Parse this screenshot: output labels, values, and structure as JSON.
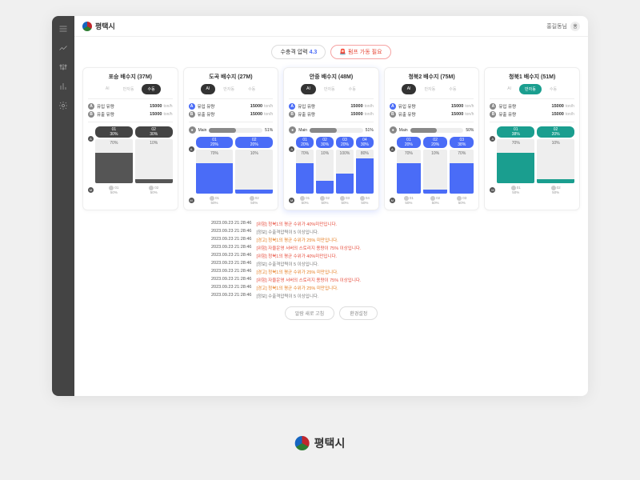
{
  "app_name": "평택시",
  "user": {
    "name": "홍길동님",
    "badge": "홍"
  },
  "top_pills": {
    "pressure": {
      "label": "수충격 압력",
      "value": "4.3"
    },
    "pump": {
      "label": "펌프 가동 필요",
      "icon": "🚨"
    }
  },
  "flow_labels": {
    "in": "유입 유량",
    "out": "유출 유량",
    "unit": "ton/h"
  },
  "mode_labels": [
    "AI",
    "반자동",
    "수동"
  ],
  "cards": [
    {
      "title": "포승 배수지 (37M)",
      "mode_active": 2,
      "mode_style": "dark",
      "hl": false,
      "in": "15000",
      "out": "15000",
      "main": null,
      "tanks": [
        {
          "tag": "01",
          "tag_style": "dark",
          "tag_pct": "30%",
          "fill": 70,
          "fill_style": "dark",
          "top": "70%",
          "foot_id": "01",
          "foot_pct": "50%"
        },
        {
          "tag": "02",
          "tag_style": "dark",
          "tag_pct": "30%",
          "fill": 10,
          "fill_style": "dark",
          "top": "10%",
          "foot_id": "02",
          "foot_pct": "50%"
        }
      ]
    },
    {
      "title": "도곡 배수지 (27M)",
      "mode_active": 0,
      "mode_style": "dark",
      "hl": false,
      "in": "15000",
      "out": "15000",
      "main": "51%",
      "tanks": [
        {
          "tag": "01",
          "tag_style": "blue",
          "tag_pct": "20%",
          "fill": 70,
          "fill_style": "blue",
          "top": "70%",
          "foot_id": "01",
          "foot_pct": "50%"
        },
        {
          "tag": "02",
          "tag_style": "blue",
          "tag_pct": "20%",
          "fill": 10,
          "fill_style": "blue",
          "top": "10%",
          "foot_id": "02",
          "foot_pct": "50%"
        }
      ]
    },
    {
      "title": "안중 배수지 (48M)",
      "mode_active": 0,
      "mode_style": "dark",
      "hl": true,
      "in": "15000",
      "out": "15000",
      "main": "51%",
      "tanks": [
        {
          "tag": "01",
          "tag_style": "blue",
          "tag_pct": "20%",
          "fill": 70,
          "fill_style": "blue",
          "top": "70%",
          "foot_id": "01",
          "foot_pct": "50%"
        },
        {
          "tag": "02",
          "tag_style": "blue",
          "tag_pct": "30%",
          "fill": 30,
          "fill_style": "blue",
          "top": "10%",
          "foot_id": "02",
          "foot_pct": "50%"
        },
        {
          "tag": "03",
          "tag_style": "blue",
          "tag_pct": "20%",
          "fill": 45,
          "fill_style": "blue",
          "top": "100%",
          "foot_id": "03",
          "foot_pct": "50%"
        },
        {
          "tag": "04",
          "tag_style": "blue",
          "tag_pct": "30%",
          "fill": 80,
          "fill_style": "blue",
          "top": "80%",
          "foot_id": "04",
          "foot_pct": "50%"
        }
      ]
    },
    {
      "title": "청북2 배수지 (75M)",
      "mode_active": 0,
      "mode_style": "dark",
      "hl": false,
      "in": "15000",
      "out": "15000",
      "main": "50%",
      "tanks": [
        {
          "tag": "01",
          "tag_style": "blue",
          "tag_pct": "20%",
          "fill": 70,
          "fill_style": "blue",
          "top": "70%",
          "foot_id": "01",
          "foot_pct": "50%"
        },
        {
          "tag": "02",
          "tag_style": "blue",
          "tag_pct": "20%",
          "fill": 10,
          "fill_style": "blue",
          "top": "10%",
          "foot_id": "02",
          "foot_pct": "50%"
        },
        {
          "tag": "03",
          "tag_style": "blue",
          "tag_pct": "38%",
          "fill": 70,
          "fill_style": "blue",
          "top": "70%",
          "foot_id": "03",
          "foot_pct": "50%"
        }
      ]
    },
    {
      "title": "청북1 배수지 (51M)",
      "mode_active": 1,
      "mode_style": "teal",
      "hl": false,
      "in": "15000",
      "out": "15000",
      "main": null,
      "tanks": [
        {
          "tag": "01",
          "tag_style": "teal",
          "tag_pct": "38%",
          "fill": 70,
          "fill_style": "teal",
          "top": "70%",
          "foot_id": "01",
          "foot_pct": "50%"
        },
        {
          "tag": "02",
          "tag_style": "teal",
          "tag_pct": "20%",
          "fill": 10,
          "fill_style": "teal",
          "top": "10%",
          "foot_id": "02",
          "foot_pct": "50%"
        }
      ]
    }
  ],
  "log": [
    {
      "t": "2023.09.23 21:28:46",
      "m": "[위험] 청북1의 평균 수위가 40%미만입니다.",
      "c": "red"
    },
    {
      "t": "2023.09.23 21:28:46",
      "m": "[정보] 수출격압력이 5 이상입니다.",
      "c": "gray"
    },
    {
      "t": "2023.09.23 21:28:46",
      "m": "[경고] 청북1의 평균 수위가 25% 미만입니다.",
      "c": "orange"
    },
    {
      "t": "2023.09.23 21:28:46",
      "m": "[위험] 자율운영 서버의 스토리지 용량이 75% 이상입니다.",
      "c": "red"
    },
    {
      "t": "2023.09.23 21:28:46",
      "m": "[위험] 청북1의 평균 수위가 40%미만입니다.",
      "c": "red"
    },
    {
      "t": "2023.09.23 21:28:46",
      "m": "[정보] 수출격압력이 5 이상입니다.",
      "c": "gray"
    },
    {
      "t": "2023.09.23 21:28:46",
      "m": "[경고] 청북1의 평균 수위가 25% 미만입니다.",
      "c": "orange"
    },
    {
      "t": "2023.09.23 21:28:46",
      "m": "[위험] 자율운영 서버의 스토리지 용량이 75% 이상입니다.",
      "c": "red"
    },
    {
      "t": "2023.09.23 21:28:46",
      "m": "[경고] 청북1의 평균 수위가 25% 미만입니다.",
      "c": "orange"
    },
    {
      "t": "2023.09.23 21:28:46",
      "m": "[정보] 수출격압력이 5 이상입니다.",
      "c": "gray"
    }
  ],
  "actions": {
    "refresh": "알람 새로 고침",
    "settings": "환경설정"
  },
  "main_label": "Main"
}
